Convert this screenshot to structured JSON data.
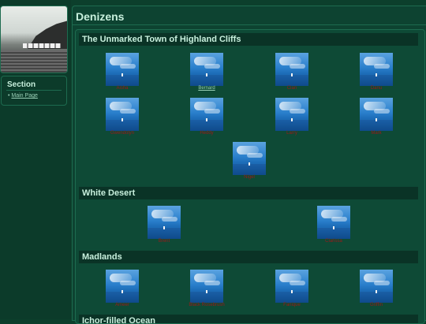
{
  "sidebar": {
    "section": {
      "title": "Section",
      "links": [
        "Main Page"
      ]
    }
  },
  "main": {
    "title": "Denizens"
  },
  "sections": [
    {
      "heading": "The Unmarked Town of Highland Cliffs",
      "residents": [
        "Aisha",
        "Bernard",
        "Cian",
        "Danu",
        "Gwendolyn",
        "Heddy",
        "Larry",
        "Mark",
        "Nigel"
      ],
      "link_index": 1
    },
    {
      "heading": "White Desert",
      "residents": [
        "Brent",
        "Clarissa"
      ]
    },
    {
      "heading": "Madlands",
      "residents": [
        "Ameer",
        "Black Rosebrush",
        "Fanique",
        "Griffin"
      ]
    },
    {
      "heading": "Ichor-filled Ocean",
      "residents": []
    }
  ]
}
